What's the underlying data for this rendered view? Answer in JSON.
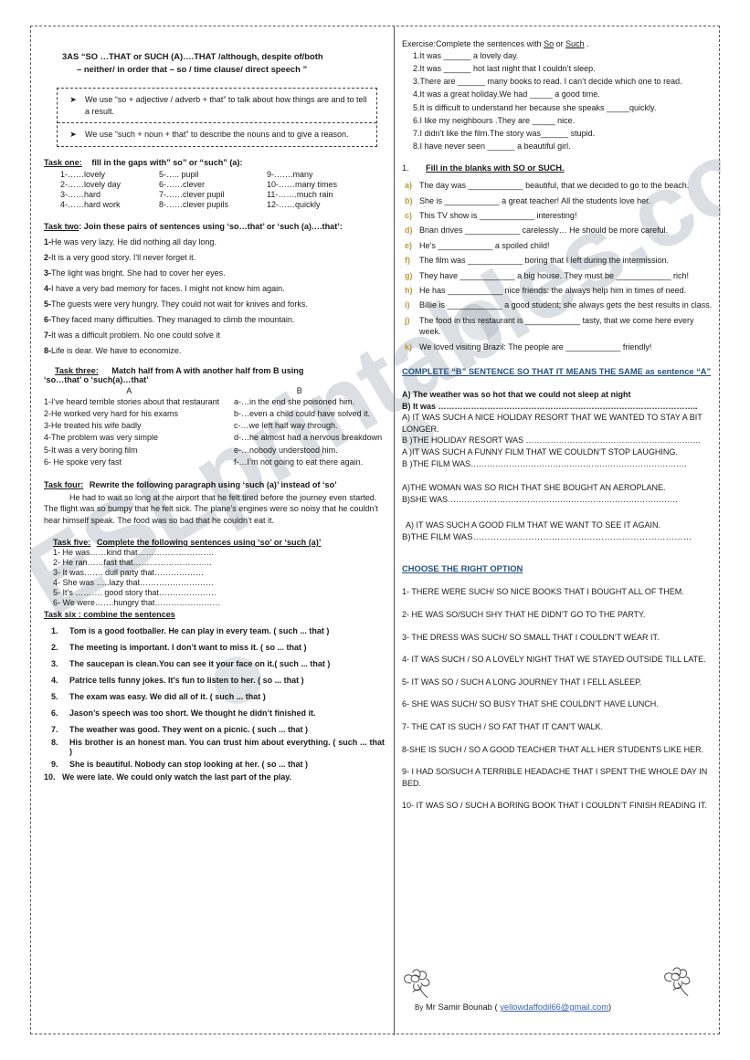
{
  "title": {
    "line1": "3AS   “SO …THAT   or   SUCH (A)….THAT /although, despite of/both",
    "line2": "– neither/ in order that – so / time clause/ direct speech ”"
  },
  "rules": {
    "bullet_glyph": "➤",
    "items": [
      "We use “so + adjective / adverb + that” to talk about how things are and to tell a result.",
      "We use “such + noun + that” to describe the nouns and to give a reason."
    ]
  },
  "task_one": {
    "heading_label": "Task one:",
    "heading_rest": "fill in the gaps with” so” or “such” (a):",
    "items": [
      "1-……lovely",
      "5-….. pupil",
      "9-…….many",
      "2-……lovely day",
      "6-……clever",
      "10-……many times",
      "3-……hard",
      "7-……clever pupil",
      "11-…….much rain",
      "4-……hard work",
      "8-……clever pupils",
      "12-……quickly"
    ]
  },
  "task_two": {
    "heading_label": "Task two",
    "heading_rest": ": Join these pairs of sentences using ‘so…that’ or ‘such (a)….that’:",
    "items": [
      {
        "num": "1-",
        "text": "He was very lazy. He did nothing all day long."
      },
      {
        "num": "2-",
        "text": "It is a very good story. I'll never forget it."
      },
      {
        "num": "3-",
        "text": "The light was bright. She had to cover her eyes."
      },
      {
        "num": "4-",
        "text": "I have a very bad memory for faces. I might not know him again."
      },
      {
        "num": "5-",
        "text": "The guests were very hungry. They could not wait for knives and forks."
      },
      {
        "num": "6-",
        "text": "They faced many difficulties. They managed to climb the mountain."
      },
      {
        "num": "7-",
        "text": "It was a difficult problem. No one could solve it"
      },
      {
        "num": "8-",
        "text": "Life is dear. We have to economize."
      }
    ]
  },
  "task_three": {
    "heading_label": "Task three:",
    "heading_rest": "Match half from A with another half from B using",
    "heading_line2": "‘so…that’ o ‘such(a)…that’",
    "col_a_label": "A",
    "col_b_label": "B",
    "rows": [
      {
        "a": "1-I’ve heard terrible stories about that restaurant",
        "b": "a-…in the end she poisoned him."
      },
      {
        "a": " 2-He worked very hard for his exams",
        "b": "b-…even a child could have solved it."
      },
      {
        "a": "3-He treated his wife badly",
        "b": "c-…we left half way through."
      },
      {
        "a": " 4-The problem was very simple",
        "b": "d-…he almost had a nervous breakdown"
      },
      {
        "a": "  5-It was a very boring film",
        "b": " e-…nobody understood him."
      },
      {
        "a": "  6- He spoke very fast",
        "b": " f-…I’m not going to eat there again."
      }
    ]
  },
  "task_four": {
    "heading_label": "Task four:",
    "heading_rest": "Rewrite the following paragraph using ‘such (a)’ instead of ‘so’",
    "paragraph": "He had to wait so long at the airport that he felt tired before the journey even started.  The   flight was so bumpy that he felt sick. The plane’s engines were so noisy that he couldn’t hear himself speak. The food was so bad that he couldn’t eat it."
  },
  "task_five": {
    "heading_label": "Task five:",
    "heading_rest": "Complete the following sentences using ‘so’ or ‘such (a)’",
    "items": [
      "1- He was……kind that……………………….",
      "2- He ran……fast that………………………..",
      "3- It was……. dull party that………………",
      "4- She was …..lazy that………………………",
      "5- It’s ………. good story that…………………",
      "6- We were…….hungry that……………………"
    ]
  },
  "task_six": {
    "heading": "Task six : combine the sentences",
    "items": [
      {
        "num": "1.",
        "text": "Tom is a good footballer. He can play in every team.  ( such ... that )"
      },
      {
        "num": "2.",
        "text": "The meeting is important. I don’t want to miss it. ( so ... that )"
      },
      {
        "num": "3.",
        "text": "The saucepan is clean.You can see it your face on it.( such ... that )"
      },
      {
        "num": "4.",
        "text": "Patrice tells funny jokes. It's fun to listen to her. ( so ... that )"
      },
      {
        "num": "5.",
        "text": "The exam was easy. We did all of it. ( such ... that )"
      },
      {
        "num": "6.",
        "text": "Jason’s speech was too short. We thought he didn’t finished it."
      },
      {
        "num": "7.",
        "text": "The weather was good. They went on a picnic. ( such ... that )"
      },
      {
        "num": "8.",
        "text": "His brother is an honest man. You can trust him about everything. ( such ... that )"
      },
      {
        "num": "9.",
        "text": "She is beautiful. Nobody can stop looking at her. ( so ... that )"
      },
      {
        "num": "10.",
        "text": "We were late. We could only watch the last part of the play."
      }
    ]
  },
  "exercise": {
    "heading_pre": "Exercise:Complete the sentences with ",
    "heading_so": "So",
    "heading_mid": " or ",
    "heading_such": "Such",
    "heading_post": " .",
    "items": [
      "1.It was ______  a lovely day.",
      "2.It was ______ hot last night that I couldn’t sleep.",
      "3.There are ______ many books to read. I can’t decide which one to read.",
      "4.It was a great holiday.We had _____ a good time.",
      "5.It is difficult to understand her because she speaks _____quickly.",
      "6.I like my neighbours .They are _____ nice.",
      "7.I didn’t like the film.The story was______ stupid.",
      "8.I have never seen ______ a beautiful girl."
    ]
  },
  "fill_blanks": {
    "number": "1.",
    "heading": "Fill in the blanks with SO or SUCH.",
    "letter_color": "#b99a3f",
    "items": [
      {
        "letter": "a)",
        "text": "The day was ____________ beautiful, that we decided to go to the beach."
      },
      {
        "letter": "b)",
        "text": "She is ____________ a great teacher! All the students love her."
      },
      {
        "letter": "c)",
        "text": "This TV show is ____________ interesting!"
      },
      {
        "letter": "d)",
        "text": "Brian drives ____________ carelessly… He should be more careful."
      },
      {
        "letter": "e)",
        "text": "He’s ____________ a spoiled child!"
      },
      {
        "letter": "f)",
        "text": "The film was ____________ boring that I left during the intermission."
      },
      {
        "letter": "g)",
        "text": "They have ____________ a big house. They must be ____________ rich!"
      },
      {
        "letter": "h)",
        "text": "He has ____________ nice friends: the always help him in times of need."
      },
      {
        "letter": "i)",
        "text": "Billie is ____________ a good student; she always gets the best results in class."
      },
      {
        "letter": "j)",
        "text": "The food in this restaurant is ____________ tasty, that we come here every week."
      },
      {
        "letter": "k)",
        "text": "We loved visiting Brazil: The people are ____________ friendly!"
      }
    ]
  },
  "complete_b": {
    "heading": "COMPLETE “B” SENTENCE SO THAT IT MEANS THE SAME as sentence “A”",
    "heading_color": "#27527f",
    "blocks": [
      {
        "lines": [
          "A) The weather was so hot that we could not sleep at night",
          "B) It was  …………………………………………………………………………………..",
          "A) IT WAS SUCH A NICE HOLIDAY RESORT THAT  WE WANTED TO STAY A BIT LONGER.",
          "B )THE HOLIDAY RESORT WAS ……………………………………………………….",
          "A )IT WAS SUCH A FUNNY FILM THAT WE COULDN’T STOP LAUGHING.",
          "B )THE FILM WAS……………………………………………………………………."
        ]
      },
      {
        "lines": [
          "A)THE WOMAN WAS SO RICH THAT SHE BOUGHT AN AEROPLANE.",
          "B)SHE WAS…………………………………………………………………………"
        ]
      },
      {
        "lines": [
          "A) IT WAS SUCH A GOOD FILM THAT WE WANT TO SEE IT AGAIN.",
          " B)THE FILM WAS…………………………………………………………………"
        ]
      }
    ]
  },
  "choose_option": {
    "heading": "CHOOSE THE RIGHT OPTION",
    "heading_color": "#27527f",
    "items": [
      "1- THERE  WERE SUCH/ SO NICE BOOKS THAT I BOUGHT ALL OF THEM.",
      "2- HE WAS SO/SUCH SHY THAT HE DIDN’T GO TO THE PARTY.",
      "3- THE DRESS WAS SUCH/ SO SMALL THAT I COULDN’T WEAR IT.",
      "4- IT WAS SUCH / SO A LOVELY NIGHT THAT WE STAYED OUTSIDE TILL LATE.",
      "5- IT WAS SO / SUCH A LONG JOURNEY THAT I FELL ASLEEP.",
      "6- SHE WAS SUCH/ SO BUSY THAT SHE COULDN’T HAVE LUNCH.",
      "7- THE CAT IS SUCH / SO FAT THAT IT CAN’T WALK.",
      "8-SHE IS SUCH / SO A GOOD TEACHER THAT ALL HER STUDENTS LIKE HER.",
      "9- I HAD SO/SUCH A TERRIBLE HEADACHE THAT I SPENT THE WHOLE       DAY IN BED.",
      "10- IT WAS SO / SUCH A BORING BOOK THAT I COULDN’T FINISH READING IT."
    ]
  },
  "footer": {
    "by": "By",
    "author": " Mr Samir Bounab ( ",
    "email": "yellowdaffodil66@gmail.com",
    "close": ")"
  },
  "watermark": {
    "text": "ESLprintables.com"
  }
}
